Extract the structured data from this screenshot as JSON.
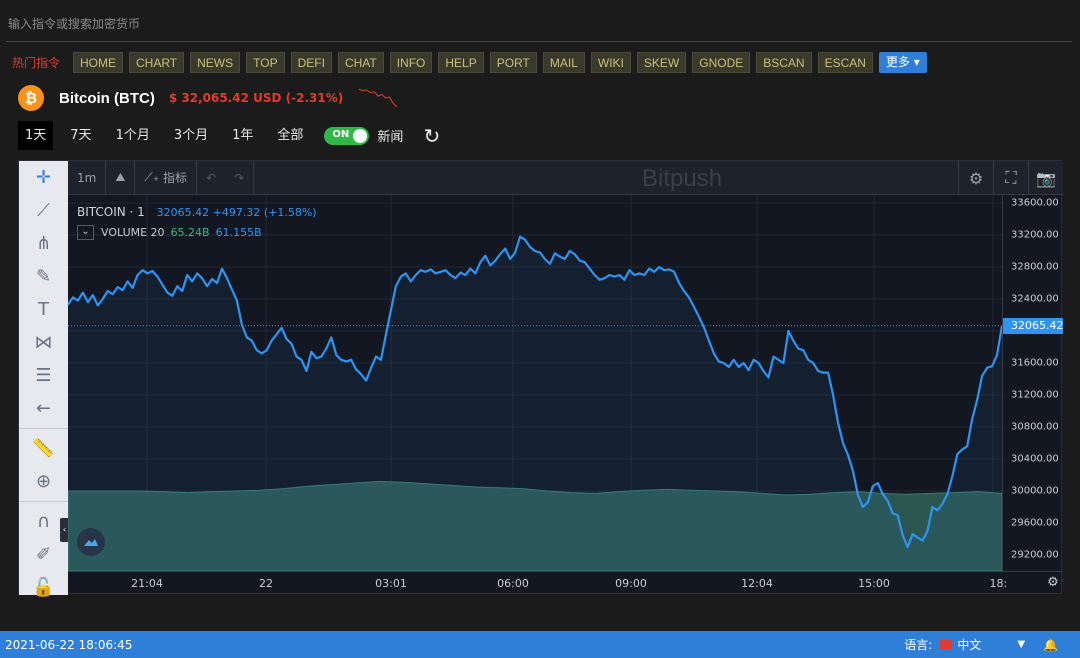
{
  "search": {
    "placeholder": "输入指令或搜索加密货币"
  },
  "hot": {
    "label": "热门指令",
    "buttons": [
      "HOME",
      "CHART",
      "NEWS",
      "TOP",
      "DEFI",
      "CHAT",
      "INFO",
      "HELP",
      "PORT",
      "MAIL",
      "WIKI",
      "SKEW",
      "GNODE",
      "BSCAN",
      "ESCAN"
    ],
    "more_label": "更多"
  },
  "coin": {
    "logo_symbol": "₿",
    "name": "Bitcoin (BTC)",
    "price": "$ 32,065.42 USD (-2.31%)",
    "sparkline": [
      33300,
      33200,
      33250,
      33100,
      33150,
      32900,
      33000,
      32800,
      32850,
      32500,
      32300
    ]
  },
  "ranges": {
    "items": [
      "1天",
      "7天",
      "1个月",
      "3个月",
      "1年",
      "全部"
    ],
    "active_index": 0,
    "toggle_label": "ON",
    "news_label": "新闻"
  },
  "toolbar": {
    "interval": "1m",
    "indicators_label": "指标",
    "watermark": "Bitpush"
  },
  "legend": {
    "symbol": "BITCOIN · 1",
    "values": "32065.42 +497.32 (+1.58%)",
    "volume_label": "VOLUME 20",
    "volume_val1": "65.24B",
    "volume_val2": "61.155B"
  },
  "chart_data": {
    "type": "line",
    "title": "",
    "xlabel": "",
    "ylabel": "",
    "ylim": [
      29000,
      33700
    ],
    "y_ticks": [
      "33600.00",
      "33200.00",
      "32800.00",
      "32400.00",
      "32000.00",
      "31600.00",
      "31200.00",
      "30800.00",
      "30400.00",
      "30000.00",
      "29600.00",
      "29200.00"
    ],
    "x_ticks": [
      "21:04",
      "22",
      "03:01",
      "06:00",
      "09:00",
      "12:04",
      "15:00",
      "18:"
    ],
    "current_price_label": "32065.42",
    "current_price": 32065.42,
    "series": [
      {
        "values": [
          32330,
          32420,
          32380,
          32480,
          32360,
          32450,
          32320,
          32400,
          32500,
          32460,
          32550,
          32510,
          32620,
          32540,
          32700,
          32760,
          32720,
          32750,
          32680,
          32580,
          32480,
          32440,
          32560,
          32500,
          32700,
          32620,
          32720,
          32660,
          32560,
          32650,
          32600,
          32780,
          32660,
          32520,
          32380,
          32080,
          31920,
          31880,
          31760,
          31720,
          31760,
          31880,
          31960,
          32040,
          31900,
          31840,
          31680,
          31640,
          31500,
          31740,
          31660,
          31680,
          31780,
          31920,
          31700,
          31640,
          31620,
          31640,
          31520,
          31460,
          31380,
          31540,
          31680,
          31640,
          31960,
          32260,
          32560,
          32680,
          32720,
          32620,
          32700,
          32760,
          32740,
          32770,
          32720,
          32740,
          32760,
          32700,
          32660,
          32730,
          32700,
          32780,
          32720,
          32860,
          32940,
          32820,
          32880,
          32960,
          33030,
          32900,
          32980,
          33180,
          33140,
          33050,
          33000,
          32980,
          32900,
          32840,
          32970,
          32930,
          32900,
          33000,
          32960,
          32880,
          32860,
          32780,
          32700,
          32640,
          32660,
          32700,
          32680,
          32700,
          32640,
          32760,
          32700,
          32720,
          32700,
          32780,
          32740,
          32800,
          32760,
          32770,
          32740,
          32600,
          32500,
          32420,
          32300,
          32180,
          32050,
          31880,
          31720,
          31620,
          31600,
          31550,
          31640,
          31550,
          31600,
          31510,
          31640,
          31600,
          31500,
          31420,
          31680,
          31640,
          31600,
          32000,
          31880,
          31780,
          31760,
          31640,
          31600,
          31500,
          31480,
          31480,
          31200,
          30850,
          30600,
          30450,
          30250,
          29950,
          29800,
          29860,
          30060,
          30100,
          29960,
          29880,
          29720,
          29700,
          29450,
          29300,
          29460,
          29420,
          29380,
          29500,
          29800,
          29760,
          29840,
          29960,
          30180,
          30460,
          30520,
          30560,
          30900,
          31140,
          31440,
          31540,
          31560,
          31700,
          32065
        ]
      }
    ],
    "volume": [
      30000,
      30000,
      30000,
      30000,
      29990,
      29980,
      29990,
      30000,
      30010,
      30030,
      30060,
      30080,
      30100,
      30120,
      30110,
      30090,
      30070,
      30050,
      30040,
      30030,
      30000,
      29980,
      29970,
      29990,
      30010,
      30020,
      30010,
      30000,
      29990,
      29970,
      29950,
      29960,
      29980,
      29990,
      29970,
      29960,
      29970,
      29980,
      29990,
      29970
    ]
  },
  "statusbar": {
    "datetime": "2021-06-22 18:06:45",
    "language_label": "语言:",
    "language_value": "中文"
  }
}
